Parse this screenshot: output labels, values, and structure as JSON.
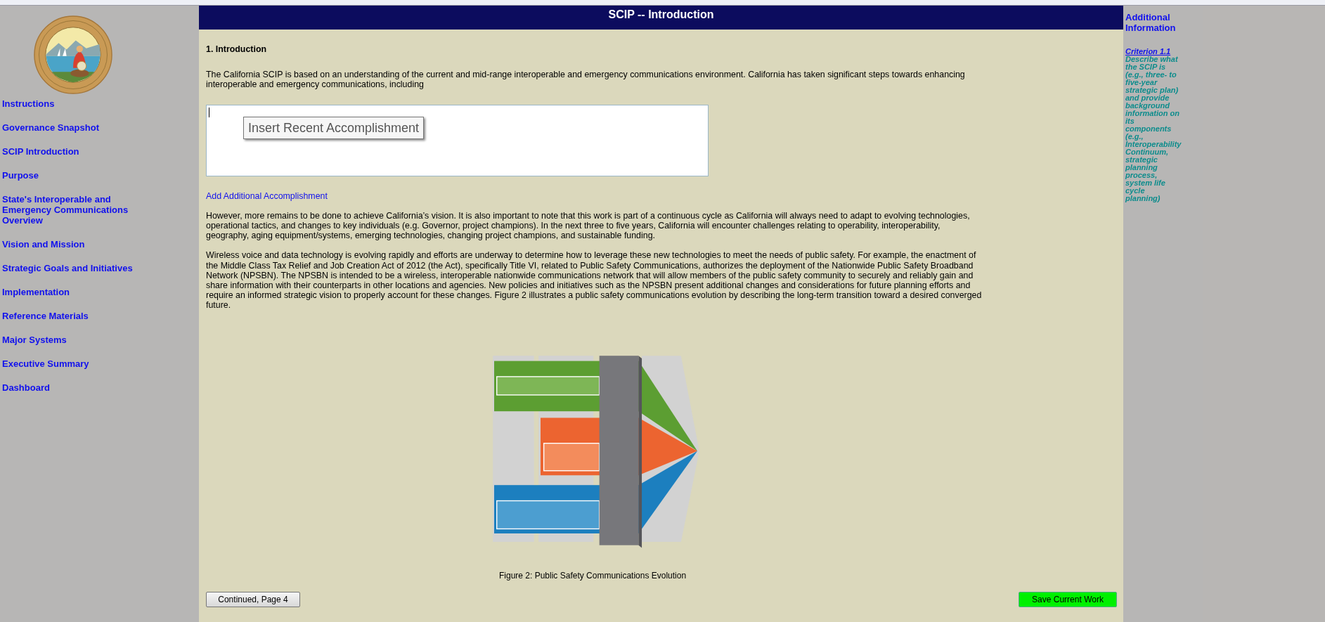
{
  "sidebar": {
    "items": [
      {
        "label": "Instructions"
      },
      {
        "label": "Governance Snapshot"
      },
      {
        "label": "SCIP Introduction"
      },
      {
        "label": "Purpose"
      },
      {
        "label": "State's Interoperable and Emergency Communications Overview"
      },
      {
        "label": "Vision and Mission"
      },
      {
        "label": "Strategic Goals and Initiatives"
      },
      {
        "label": "Implementation"
      },
      {
        "label": "Reference Materials"
      },
      {
        "label": "Major Systems"
      },
      {
        "label": "Executive Summary"
      },
      {
        "label": "Dashboard"
      }
    ]
  },
  "main": {
    "title": "SCIP -- Introduction",
    "heading": "1. Introduction",
    "intro": "The California SCIP is based on an understanding of the current and mid-range interoperable and emergency communications environment. California has taken significant steps towards enhancing interoperable and emergency communications, including",
    "accomplishment_field": {
      "tooltip": "Insert Recent Accomplishment"
    },
    "add_link": "Add Additional Accomplishment",
    "paragraphs": [
      "However, more remains to be done to achieve California’s vision. It is also important to note that this work is part of a continuous cycle as California will always need to adapt to evolving technologies, operational tactics, and changes to key individuals (e.g. Governor, project champions). In the next three to five years, California will encounter challenges relating to operability, interoperability, geography, aging equipment/systems, emerging technologies, changing project champions, and sustainable funding.",
      "Wireless voice and data technology is evolving rapidly and efforts are underway to determine how to leverage these new technologies to meet the needs of public safety. For example, the enactment of the Middle Class Tax Relief and Job Creation Act of 2012 (the Act), specifically Title VI, related to Public Safety Communications, authorizes the deployment of the Nationwide Public Safety Broadband Network (NPSBN). The NPSBN is intended to be a wireless, interoperable nationwide communications network that will allow members of the public safety community to securely and reliably gain and share information with their counterparts in other locations and agencies. New policies and initiatives such as the NPSBN present additional changes and considerations for future planning efforts and require an informed strategic vision to properly account for these changes. Figure 2 illustrates a public safety communications evolution by describing the long-term transition toward a desired converged future."
    ],
    "figure": {
      "kind": "picture",
      "caption": "Figure 2: Public Safety Communications Evolution"
    },
    "buttons": {
      "continue": "Continued, Page 4",
      "save": "Save Current Work"
    }
  },
  "info_panel": {
    "title": "Additional Information",
    "criterion_link": "Criterion 1.1",
    "text": "Describe what the SCIP is (e.g., three- to five-year strategic plan) and provide background information on its components (e.g., Interoperability Continuum, strategic planning process, system life cycle planning)"
  }
}
